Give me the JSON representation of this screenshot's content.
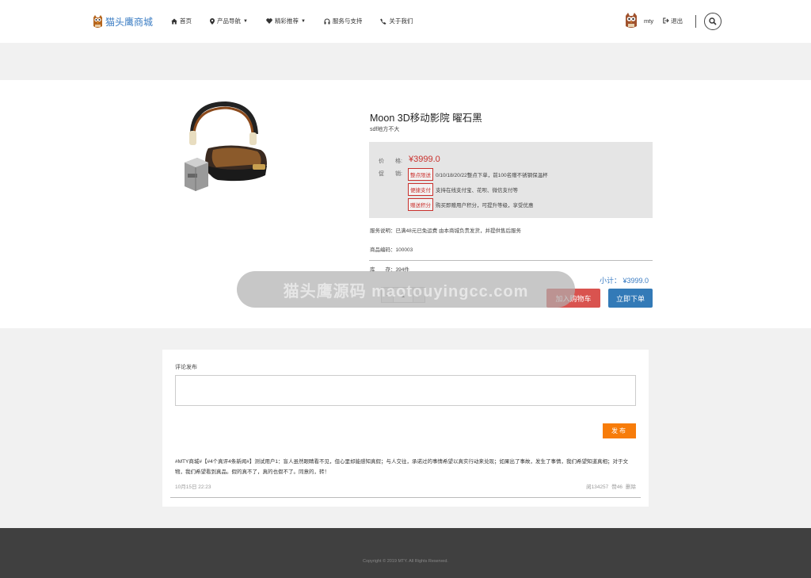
{
  "header": {
    "logo_text": "猫头鹰商城",
    "nav": [
      {
        "label": "首页",
        "icon": "home-icon"
      },
      {
        "label": "产品导航",
        "icon": "map-marker-icon",
        "dropdown": true
      },
      {
        "label": "精彩推荐",
        "icon": "heart-icon",
        "dropdown": true
      },
      {
        "label": "服务与支持",
        "icon": "headphones-icon"
      },
      {
        "label": "关于我们",
        "icon": "phone-icon"
      }
    ],
    "username": "mty",
    "logout_label": "退出"
  },
  "product": {
    "title": "Moon 3D移动影院 曜石黑",
    "subtitle": "sdf地方不大",
    "price_label": "价　　格:",
    "price": "¥3999.0",
    "promo_label": "促　　销:",
    "promos": [
      {
        "tag": "整点限送",
        "text": "0/10/18/20/22整点下单，前100名赠不锈钢保温杯"
      },
      {
        "tag": "便捷支付",
        "text": "支持在线支付宝、花呗、微信支付等"
      },
      {
        "tag": "赠送积分",
        "text": "购买即赠用户积分，可提升等级，享受优惠"
      }
    ],
    "service": "服务说明：已满48元已免运费 由本商城负责发货，并提供售后服务",
    "code": "商品编码：100003",
    "stock": "库　　存：394件",
    "subtotal": "小计：  ¥3999.0",
    "quantity": "1",
    "minus": "-",
    "plus": "+",
    "add_cart_label": "加入购物车",
    "buy_label": "立即下单",
    "watermark": "猫头鹰源码 maotouyingcc.com"
  },
  "comments": {
    "label": "评论发布",
    "submit_label": "发布",
    "items": [
      {
        "content": "#MTY商城#【#4个真评4条新闻#】测试用户1：盲人虽然眼睛看不见，但心里却能感知真假；与人交往，承诺过的事情希望以真实行动来兑现；如果出了事故，发生了事情，我们希望知道真相；对于文物，我们希望看到真品。假的真不了，真的也假不了。同意的，转！",
        "date": "10月15日 22:23",
        "views": "阅134257",
        "likes": "赞46",
        "delete": "删除"
      }
    ]
  },
  "footer": {
    "copyright": "Copyright © 2019 MTY. All Rights Reserved."
  },
  "colors": {
    "accent_blue": "#337ab7",
    "accent_red": "#d9534f",
    "price_red": "#c9302c",
    "submit_orange": "#f77c0a",
    "footer_bg": "#404040"
  }
}
